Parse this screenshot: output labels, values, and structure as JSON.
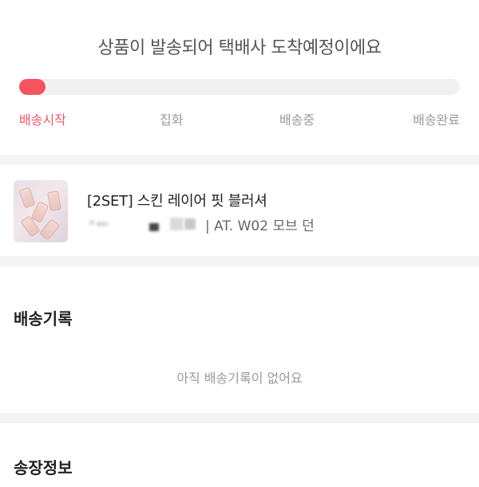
{
  "status": {
    "title": "상품이 발송되어 택배사 도착예정이에요",
    "progress": 0.06,
    "accent_color": "#f5535e",
    "steps": [
      {
        "label": "배송시작",
        "active": true
      },
      {
        "label": "집화",
        "active": false
      },
      {
        "label": "배송중",
        "active": false
      },
      {
        "label": "배송완료",
        "active": false
      }
    ]
  },
  "product": {
    "name": "[2SET] 스킨 레이어 핏 블러셔",
    "option_visible": "| AT. W02 모브 던"
  },
  "history": {
    "title": "배송기록",
    "empty_message": "아직 배송기록이 없어요"
  },
  "invoice": {
    "title": "송장정보"
  }
}
